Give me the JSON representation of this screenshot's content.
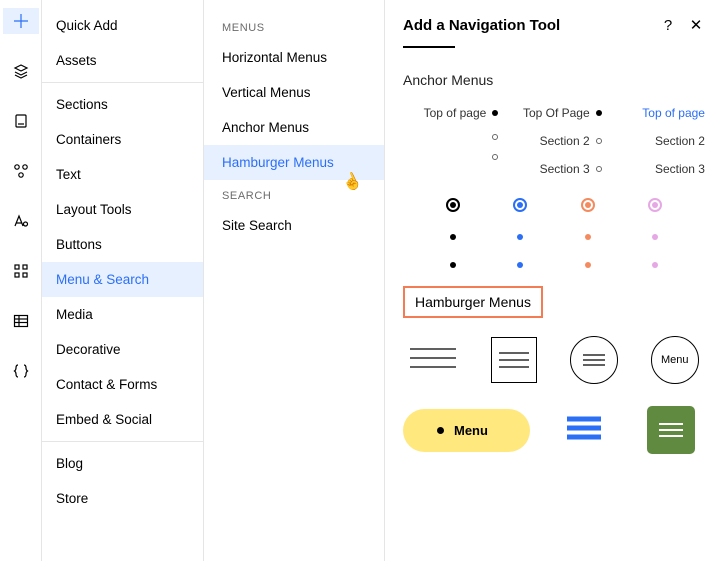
{
  "iconbar": [
    "plus-icon",
    "layers-icon",
    "page-icon",
    "apps-icon",
    "typography-icon",
    "grid-icon",
    "table-icon",
    "braces-icon"
  ],
  "col1": {
    "groups": [
      [
        "Quick Add",
        "Assets"
      ],
      [
        "Sections",
        "Containers",
        "Text",
        "Layout Tools",
        "Buttons",
        "Menu & Search",
        "Media",
        "Decorative",
        "Contact & Forms",
        "Embed & Social"
      ],
      [
        "Blog",
        "Store"
      ]
    ],
    "selected": "Menu & Search"
  },
  "col2": {
    "menus_label": "MENUS",
    "menus": [
      "Horizontal Menus",
      "Vertical Menus",
      "Anchor Menus",
      "Hamburger Menus"
    ],
    "search_label": "SEARCH",
    "search": [
      "Site Search"
    ],
    "selected": "Hamburger Menus"
  },
  "panel": {
    "title": "Add a Navigation Tool",
    "anchor_title": "Anchor Menus",
    "anchor_cols": [
      {
        "style": "black",
        "labels": [
          "Top of page",
          "",
          ""
        ]
      },
      {
        "style": "black",
        "labels": [
          "Top Of Page",
          "Section 2",
          "Section 3"
        ]
      },
      {
        "style": "blue",
        "labels": [
          "Top of page",
          "Section 2",
          "Section 3"
        ],
        "selected": 0
      }
    ],
    "dot_colors": [
      "#000000",
      "#2b6ff6",
      "#f48b5f",
      "#e6a8e4"
    ],
    "ham_title": "Hamburger Menus",
    "ham4_label": "Menu",
    "pill_label": "Menu"
  }
}
